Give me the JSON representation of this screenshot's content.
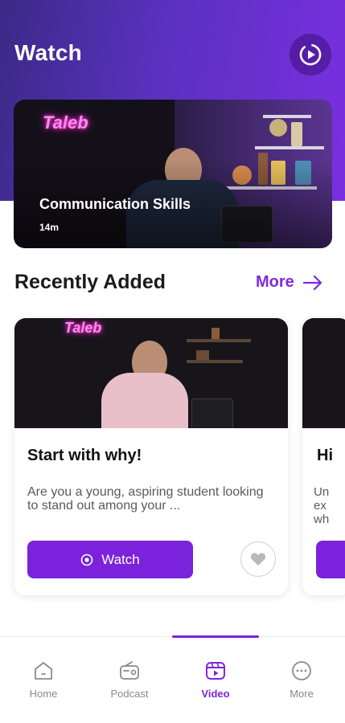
{
  "colors": {
    "brand": "#7b22dc",
    "header_gradient_start": "#3a2a86",
    "header_gradient_end": "#7a2fe0",
    "inactive": "#8a8a8a"
  },
  "header": {
    "title": "Watch",
    "action_icon": "play-circle-icon"
  },
  "featured": {
    "logo": "Taleb",
    "title": "Communication Skills",
    "duration": "14m"
  },
  "recent": {
    "title": "Recently Added",
    "more_label": "More",
    "cards": [
      {
        "logo": "Taleb",
        "title": "Start with why!",
        "description": "Are you a young, aspiring student looking to stand out among your ...",
        "watch_label": "Watch"
      },
      {
        "title": "Hi",
        "description": "Un ex wh"
      }
    ]
  },
  "tabs": [
    {
      "label": "Home",
      "icon": "home-icon",
      "active": false
    },
    {
      "label": "Podcast",
      "icon": "radio-icon",
      "active": false
    },
    {
      "label": "Video",
      "icon": "video-icon",
      "active": true
    },
    {
      "label": "More",
      "icon": "more-icon",
      "active": false
    }
  ]
}
